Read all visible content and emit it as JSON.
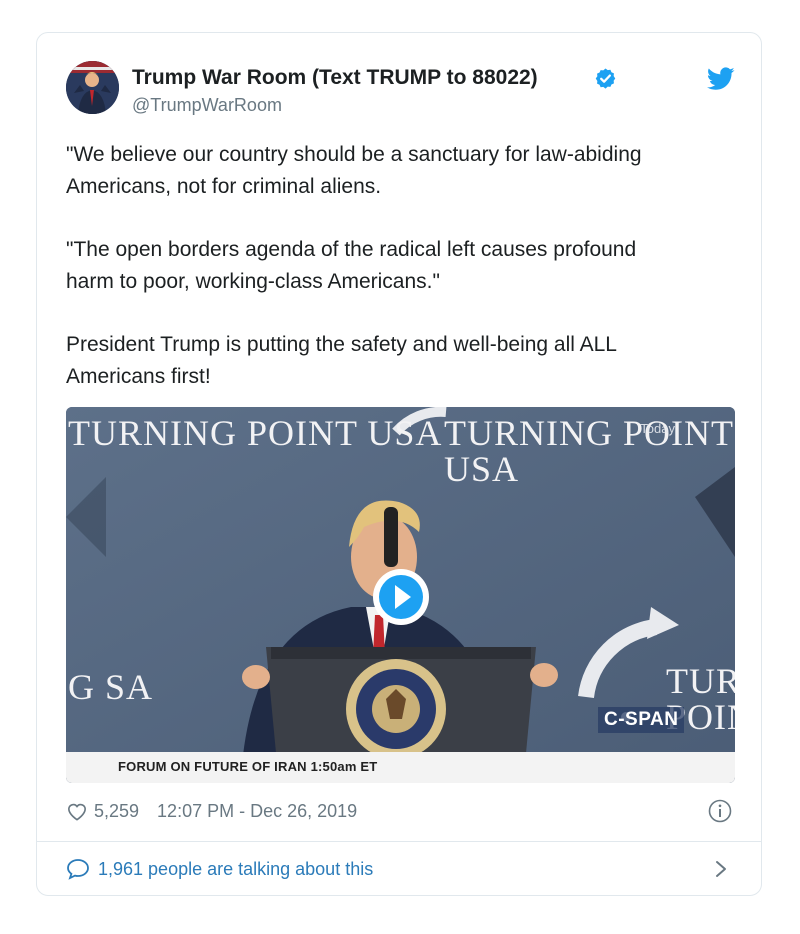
{
  "author": {
    "display_name": "Trump War Room (Text TRUMP to 88022)",
    "handle": "@TrumpWarRoom",
    "verified": true
  },
  "tweet": {
    "paragraphs": [
      "\"We believe our country should be a sanctuary for law-abiding\nAmericans, not for criminal aliens.",
      "\"The open borders agenda of the radical left causes profound\nharm to poor, working-class Americans.\"",
      "President Trump is putting the safety and well-being all ALL\nAmericans first!"
    ]
  },
  "media": {
    "stage_text_left": "TURNING\nPOINT USA",
    "stage_text_right": "TURNING\nPOINT USA",
    "stage_text_edge_left": "G\nSA",
    "stage_text_edge_right": "TURN\nPOIN",
    "badge": "Today",
    "network_logo": "C-SPAN",
    "caption": "FORUM ON FUTURE OF IRAN  1:50am ET",
    "play_icon": "play-icon"
  },
  "meta": {
    "likes": "5,259",
    "timestamp": "12:07 PM - Dec 26, 2019",
    "talking": "1,961 people are talking about this"
  },
  "colors": {
    "verified_blue": "#1da1f2",
    "link_blue": "#2b7bb9",
    "muted_gray": "#697882",
    "border": "#e1e8ed"
  }
}
